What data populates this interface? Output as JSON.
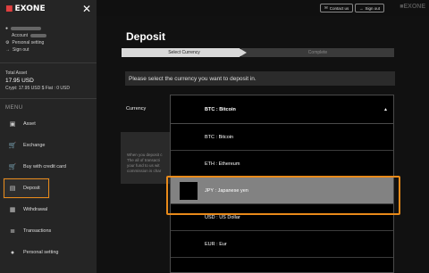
{
  "app": {
    "logo_text": "EXONE",
    "logo_mark": "■"
  },
  "sidebar": {
    "close_glyph": "✕",
    "account_label": "Account",
    "personal_setting": "Personal setting",
    "sign_out": "Sign out",
    "total_asset_label": "Total Asset",
    "total_asset_value": "17.95 USD",
    "crypt_line": "Crypt: 17.95 USD $ Fiat : 0 USD",
    "menu_title": "MENU",
    "items": [
      {
        "label": "Asset",
        "icon": "camera-icon"
      },
      {
        "label": "Exchange",
        "icon": "cart-icon"
      },
      {
        "label": "Buy with credit card",
        "icon": "cart-icon"
      },
      {
        "label": "Deposit",
        "icon": "deposit-icon"
      },
      {
        "label": "Withdrawal",
        "icon": "withdrawal-icon"
      },
      {
        "label": "Transactions",
        "icon": "transactions-icon"
      },
      {
        "label": "Personal setting",
        "icon": "person-icon"
      }
    ],
    "active_index": 3
  },
  "topbar": {
    "contact_us": "Contact us",
    "sign_out": "Sign out",
    "logo_text": "EXONE"
  },
  "main": {
    "title": "Deposit",
    "steps": [
      "Select Currency",
      "Complete"
    ],
    "prompt": "Please select the currency you want to deposit in.",
    "currency_label": "Currency",
    "info_lines": [
      "When you deposit c",
      "The all of transacti",
      "your fund to us wit",
      "commission is char"
    ]
  },
  "dropdown": {
    "selected": "BTC : Bitcoin",
    "options": [
      "BTC : Bitcoin",
      "ETH : Ethereum",
      "JPY : Japanese yen",
      "USD : US Dollar",
      "EUR : Eur"
    ],
    "highlighted_index": 2
  },
  "colors": {
    "accent": "#e88a1a",
    "sidebar_bg": "#252525",
    "main_bg": "#111111"
  }
}
